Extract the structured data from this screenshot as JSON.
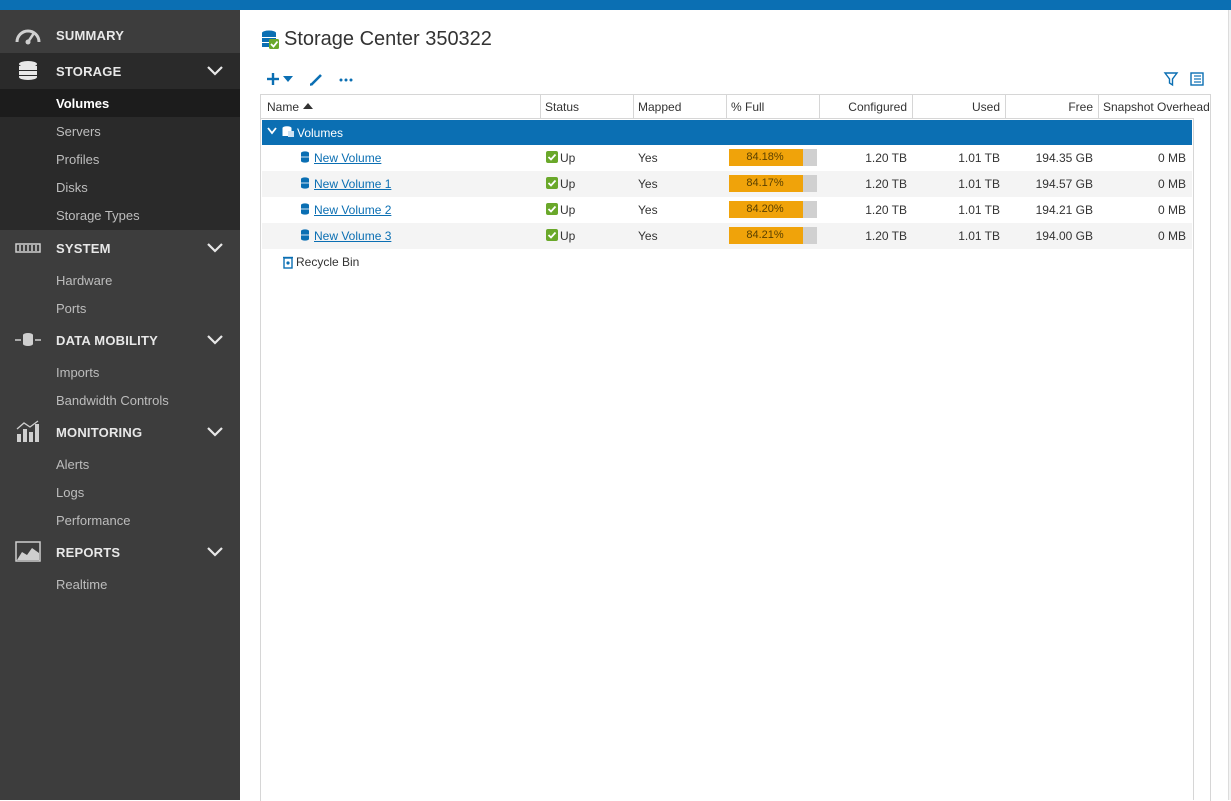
{
  "sidebar": {
    "sections": [
      {
        "label": "SUMMARY",
        "icon": "gauge-icon"
      },
      {
        "label": "STORAGE",
        "icon": "database-icon",
        "items": [
          "Volumes",
          "Servers",
          "Profiles",
          "Disks",
          "Storage Types"
        ],
        "selected": "Volumes"
      },
      {
        "label": "SYSTEM",
        "icon": "hardware-icon",
        "items": [
          "Hardware",
          "Ports"
        ]
      },
      {
        "label": "DATA MOBILITY",
        "icon": "data-mobility-icon",
        "items": [
          "Imports",
          "Bandwidth Controls"
        ]
      },
      {
        "label": "MONITORING",
        "icon": "bar-chart-icon",
        "items": [
          "Alerts",
          "Logs",
          "Performance"
        ]
      },
      {
        "label": "REPORTS",
        "icon": "area-chart-icon",
        "items": [
          "Realtime"
        ]
      }
    ]
  },
  "header": {
    "title": "Storage Center 350322"
  },
  "toolbar": {
    "icons": [
      "add-dropdown-icon",
      "edit-pencil-icon",
      "more-icon",
      "filter-icon",
      "columns-icon"
    ]
  },
  "table": {
    "columns": [
      "Name",
      "Status",
      "Mapped",
      "% Full",
      "Configured",
      "Used",
      "Free",
      "Snapshot Overhead"
    ],
    "sort_column": "Name",
    "group_label": "Volumes",
    "rows": [
      {
        "name": "New Volume",
        "status": "Up",
        "mapped": "Yes",
        "pct_label": "84.18%",
        "pct": 84.18,
        "configured": "1.20 TB",
        "used": "1.01 TB",
        "free": "194.35 GB",
        "snapshot": "0 MB"
      },
      {
        "name": "New Volume 1",
        "status": "Up",
        "mapped": "Yes",
        "pct_label": "84.17%",
        "pct": 84.17,
        "configured": "1.20 TB",
        "used": "1.01 TB",
        "free": "194.57 GB",
        "snapshot": "0 MB"
      },
      {
        "name": "New Volume 2",
        "status": "Up",
        "mapped": "Yes",
        "pct_label": "84.20%",
        "pct": 84.2,
        "configured": "1.20 TB",
        "used": "1.01 TB",
        "free": "194.21 GB",
        "snapshot": "0 MB"
      },
      {
        "name": "New Volume 3",
        "status": "Up",
        "mapped": "Yes",
        "pct_label": "84.21%",
        "pct": 84.21,
        "configured": "1.20 TB",
        "used": "1.01 TB",
        "free": "194.00 GB",
        "snapshot": "0 MB"
      }
    ],
    "recycle_bin": "Recycle Bin"
  },
  "colors": {
    "accent": "#0b6fb3",
    "bar_fill": "#f0a30a",
    "status_ok": "#6aa82a"
  }
}
